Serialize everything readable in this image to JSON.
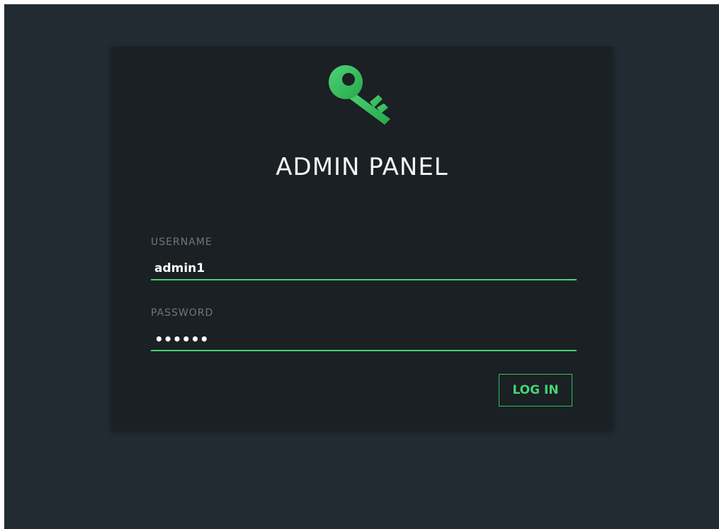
{
  "panel": {
    "title": "ADMIN PANEL",
    "logo_icon": "key-icon",
    "accent_color": "#44d373"
  },
  "form": {
    "username_label": "USERNAME",
    "username_value": "admin1",
    "password_label": "PASSWORD",
    "password_value": "••••••",
    "submit_label": "LOG IN"
  }
}
